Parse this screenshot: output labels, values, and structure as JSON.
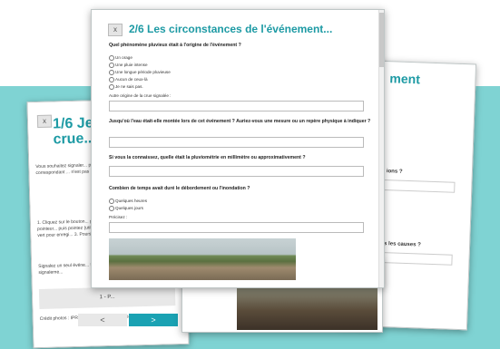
{
  "front": {
    "close": "x",
    "title": "2/6 Les circonstances de l'événement...",
    "q1": "Quel phénomène pluvieux était à l'origine de l'événement ?",
    "q1_options": [
      "Un orage",
      "Une pluie intense",
      "Une longue période pluvieuse",
      "Aucun de ceux-là",
      "Je ne sais pas."
    ],
    "other_label": "Autre origine de la crue signalée :",
    "q2": "Jusqu'où l'eau était-elle montée lors de cet événement ? Auriez-vous une mesure ou un repère physique à indiquer ?",
    "q3": "Si vous la connaissez, quelle était la pluviométrie en millimètre ou approximativement ?",
    "q4": "Combien de temps avait duré le débordement ou l'inondation ?",
    "q4_options": [
      "Quelques heures",
      "Quelques jours"
    ],
    "precisez": "Précisez :"
  },
  "left": {
    "close": "x",
    "title": "1/6 Je s... de crue... Vallées",
    "para": "Vous souhaitez signaler... proximité d'age cet év... rouge correspondant ... n'est pas possible, soit app...",
    "band": "1 - P...",
    "instructions": "1. Cliquez sur le bouton... pointeur bleu apparaît... 2. Déplacez le pointeur... puis pointez (utilisez l... souris ou les doigts) po... bouton vert pour enregi... 3. Poursuivez le questi...",
    "note": "Signalez un seul événe... fois cliqué sur \"Termin... un nouveau signaleme...",
    "credits": "Crédit photos : IPRe, SMBA, RTM et Régies d'environnement",
    "prev": "<",
    "next": ">"
  },
  "right": {
    "title": "ment",
    "q_a": "ions ?",
    "q_b": "s les causes ?"
  }
}
